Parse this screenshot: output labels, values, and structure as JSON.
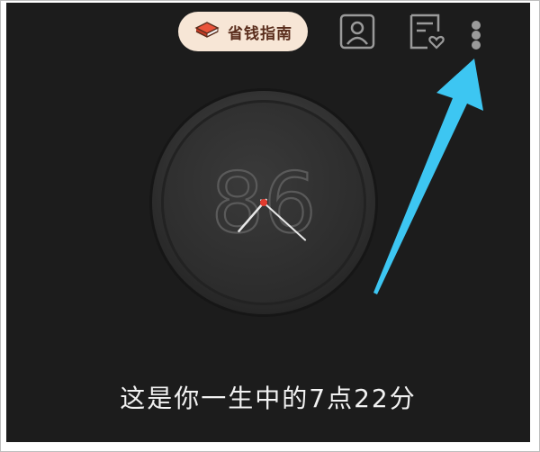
{
  "header": {
    "guide_button_label": "省钱指南",
    "icons": {
      "guide": "book-icon",
      "profile": "profile-icon",
      "favorites": "favorites-icon",
      "more": "more-vertical-icon"
    }
  },
  "clock": {
    "watermark_text": "86",
    "hour": 7,
    "minute": 22,
    "second_hand_color": "#e23b2e"
  },
  "caption": "这是你一生中的7点22分",
  "colors": {
    "background": "#1c1c1c",
    "accent_arrow": "#3dc6f2",
    "guide_button_bg": "#f7e6d6"
  }
}
